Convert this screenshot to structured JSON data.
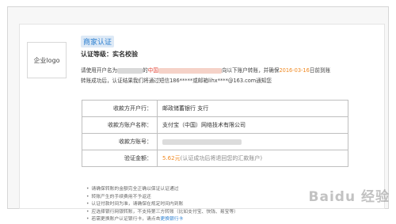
{
  "logo": {
    "label": "企业logo"
  },
  "company": {
    "name": "商家认证"
  },
  "cert": {
    "level_label": "认证等级：",
    "level_value": "实名校验"
  },
  "notice": {
    "p1": "请使用开户名为",
    "p2": "的",
    "bank": "中国",
    "p3": "向以下账户转账，并确保",
    "date": "2016-03-16",
    "p4": "日前到账",
    "line2": "转账成功后，认证结果我们将通过短信186*****或邮箱lihx****@163.com通知您"
  },
  "table": {
    "rows": [
      {
        "key": "收款方开户行：",
        "value": "邮政储蓄银行 支行"
      },
      {
        "key": "收款方账户名称：",
        "value": "支付宝（中国）网络技术有限公司"
      },
      {
        "key": "收款方账号：",
        "value": ""
      },
      {
        "key": "验证金额：",
        "value": "5.62元",
        "note": "(认证成功后将退回您的汇款账户)"
      }
    ]
  },
  "notes": [
    "请确保转账的金额完全正确以保证认证通过",
    "转账产生的手续费用不予返还",
    "认证付款时间为准，请确保在规定时间内到账",
    "应选择银行网银转账，不支持第三方转账（比如支付宝、快钱、易宝等）",
    "若需更换账户认证银行卡，请点击"
  ],
  "notes_link": "更换银行卡",
  "watermark": {
    "text": "Baidu 经验"
  }
}
